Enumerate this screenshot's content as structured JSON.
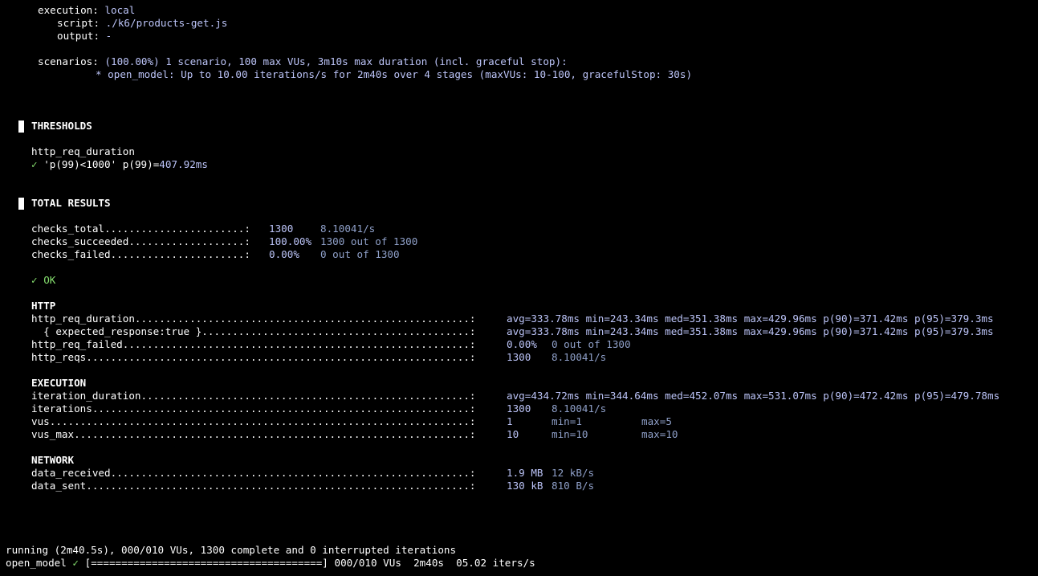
{
  "header": {
    "execution_label": "execution:",
    "execution_value": "local",
    "script_label": "script:",
    "script_value": "./k6/products-get.js",
    "output_label": "output:",
    "output_value": "-",
    "scenarios_label": "scenarios:",
    "scenarios_value": "(100.00%) 1 scenario, 100 max VUs, 3m10s max duration (incl. graceful stop):",
    "scenario_line": "* open_model: Up to 10.00 iterations/s for 2m40s over 4 stages (maxVUs: 10-100, gracefulStop: 30s)"
  },
  "thresholds": {
    "title": "THRESHOLDS",
    "metric": "http_req_duration",
    "check_mark": "✓",
    "rule": "'p(99)<1000'",
    "result_label": "p(99)=",
    "result_value": "407.92ms"
  },
  "total_results": {
    "title": "TOTAL RESULTS",
    "checks": [
      {
        "label": "checks_total.......................:",
        "value": "1300",
        "extra": "8.10041/s"
      },
      {
        "label": "checks_succeeded...................:",
        "value": "100.00%",
        "extra": "1300 out of 1300"
      },
      {
        "label": "checks_failed......................:",
        "value": "0.00%",
        "extra": "0 out of 1300"
      }
    ],
    "ok_mark": "✓",
    "ok_label": "OK"
  },
  "http": {
    "title": "HTTP",
    "rows": [
      {
        "label": "http_req_duration.......................................................:",
        "value": "avg=333.78ms min=243.34ms med=351.38ms max=429.96ms p(90)=371.42ms p(95)=379.3ms"
      },
      {
        "label": "  { expected_response:true }............................................:",
        "value": "avg=333.78ms min=243.34ms med=351.38ms max=429.96ms p(90)=371.42ms p(95)=379.3ms"
      },
      {
        "label": "http_req_failed.........................................................:",
        "value": "0.00%",
        "extra": "0 out of 1300"
      },
      {
        "label": "http_reqs...............................................................:",
        "value": "1300",
        "extra": "8.10041/s"
      }
    ]
  },
  "execution": {
    "title": "EXECUTION",
    "rows": [
      {
        "label": "iteration_duration......................................................:",
        "value": "avg=434.72ms min=344.64ms med=452.07ms max=531.07ms p(90)=472.42ms p(95)=479.78ms"
      },
      {
        "label": "iterations..............................................................:",
        "value": "1300",
        "extra": "8.10041/s"
      },
      {
        "label": "vus.....................................................................:",
        "value": "1",
        "min": "min=1",
        "max": "max=5"
      },
      {
        "label": "vus_max.................................................................:",
        "value": "10",
        "min": "min=10",
        "max": "max=10"
      }
    ]
  },
  "network": {
    "title": "NETWORK",
    "rows": [
      {
        "label": "data_received...........................................................:",
        "value": "1.9 MB",
        "extra": "12 kB/s"
      },
      {
        "label": "data_sent...............................................................:",
        "value": "130 kB",
        "extra": "810 B/s"
      }
    ]
  },
  "footer": {
    "running": "running (2m40.5s), 000/010 VUs, 1300 complete and 0 interrupted iterations",
    "scenario_name": "open_model",
    "check_mark": "✓",
    "progress_bar": "[======================================]",
    "progress_fraction": 1.0,
    "status": "000/010 VUs  2m40s  05.02 iters/s"
  },
  "colors": {
    "background": "#000000",
    "text": "#ffffff",
    "value": "#bcc4f8",
    "secondary": "#8fa0c9",
    "success": "#86e06f"
  }
}
